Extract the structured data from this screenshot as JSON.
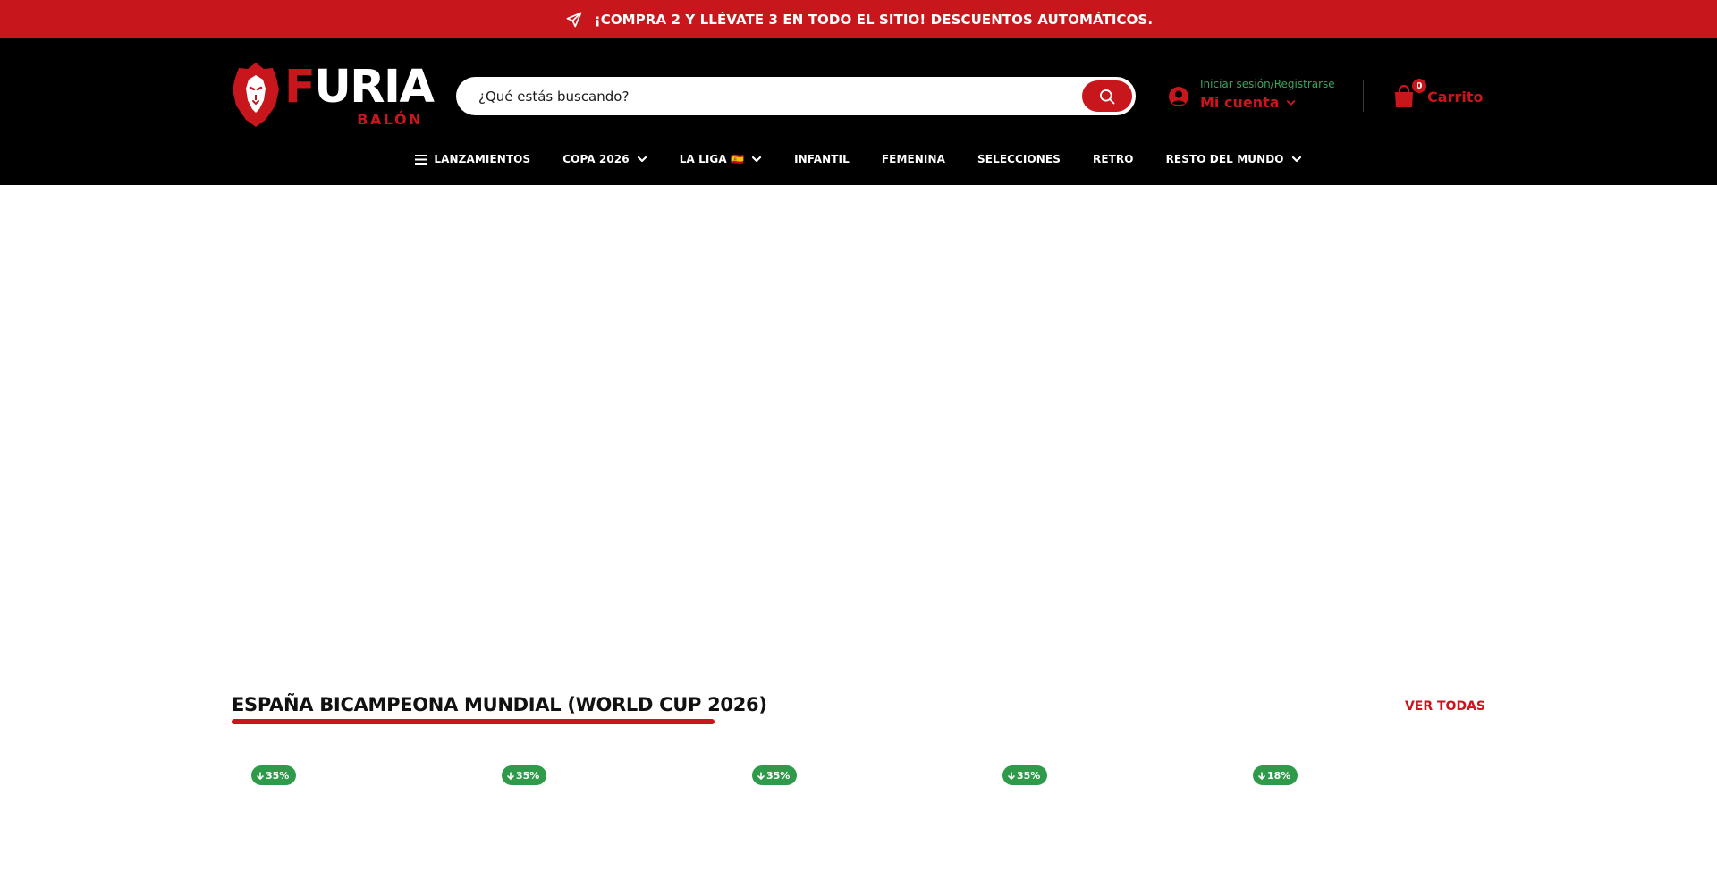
{
  "announcement": {
    "text": "¡COMPRA 2 Y LLÉVATE 3 EN TODO EL SITIO! DESCUENTOS AUTOMÁTICOS.",
    "icon": "paper-plane-icon"
  },
  "logo": {
    "word_first": "F",
    "word_rest": "URIA",
    "sub": "BALÓN"
  },
  "search": {
    "placeholder": "¿Qué estás buscando?",
    "button_icon": "search-icon"
  },
  "account": {
    "login_label": "Iniciar sesión/Registrarse",
    "account_label": "Mi cuenta",
    "icon": "user-circle-icon"
  },
  "cart": {
    "count": "0",
    "label": "Carrito",
    "icon": "shopping-bag-icon"
  },
  "nav": {
    "items": [
      {
        "label": "LANZAMIENTOS",
        "icon": "menu-icon",
        "dropdown": false
      },
      {
        "label": "COPA 2026",
        "dropdown": true
      },
      {
        "label": "LA LIGA 🇪🇸",
        "dropdown": true
      },
      {
        "label": "INFANTIL",
        "dropdown": false
      },
      {
        "label": "FEMENINA",
        "dropdown": false
      },
      {
        "label": "SELECCIONES",
        "dropdown": false
      },
      {
        "label": "RETRO",
        "dropdown": false
      },
      {
        "label": "RESTO DEL MUNDO",
        "dropdown": true
      }
    ]
  },
  "section": {
    "title": "ESPAÑA BICAMPEONA MUNDIAL (WORLD CUP 2026)",
    "view_all": "VER TODAS"
  },
  "products": [
    {
      "discount": "35%"
    },
    {
      "discount": "35%"
    },
    {
      "discount": "35%"
    },
    {
      "discount": "35%"
    },
    {
      "discount": "18%"
    }
  ],
  "colors": {
    "brand_red": "#c8161d",
    "header_bg": "#000000",
    "discount_green": "#2e9a4a",
    "login_green": "#3ca35d"
  }
}
